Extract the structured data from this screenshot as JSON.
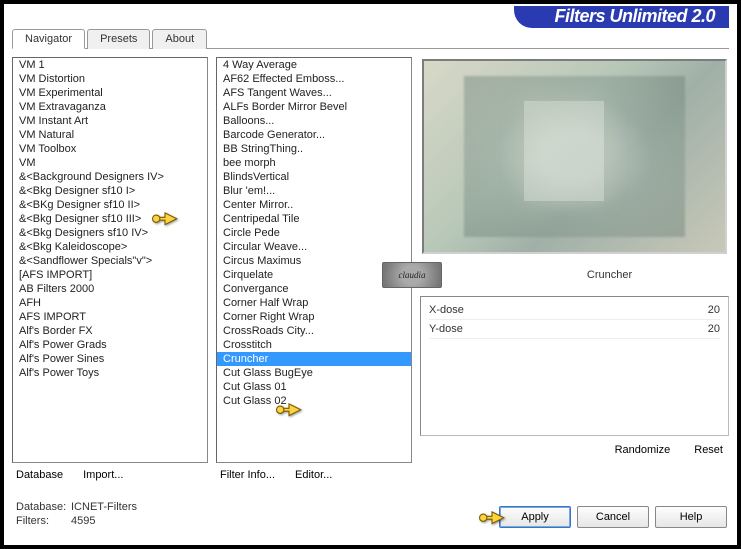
{
  "app_title": "Filters Unlimited 2.0",
  "tabs": [
    "Navigator",
    "Presets",
    "About"
  ],
  "active_tab": 0,
  "categories": [
    "VM 1",
    "VM Distortion",
    "VM Experimental",
    "VM Extravaganza",
    "VM Instant Art",
    "VM Natural",
    "VM Toolbox",
    "VM",
    "&<Background Designers IV>",
    "&<Bkg Designer sf10 I>",
    "&<BKg Designer sf10 II>",
    "&<Bkg Designer sf10 III>",
    "&<Bkg Designers sf10 IV>",
    "&<Bkg Kaleidoscope>",
    "&<Sandflower Specials\"v\">",
    "[AFS IMPORT]",
    "AB Filters 2000",
    "AFH",
    "AFS IMPORT",
    "Alf's Border FX",
    "Alf's Power Grads",
    "Alf's Power Sines",
    "Alf's Power Toys"
  ],
  "selected_category_index": 9,
  "filters": [
    "4 Way Average",
    "AF62 Effected Emboss...",
    "AFS Tangent Waves...",
    "ALFs Border Mirror Bevel",
    "Balloons...",
    "Barcode Generator...",
    "BB StringThing..",
    "bee morph",
    "BlindsVertical",
    "Blur 'em!...",
    "Center Mirror..",
    "Centripedal Tile",
    "Circle Pede",
    "Circular Weave...",
    "Circus Maximus",
    "Cirquelate",
    "Convergance",
    "Corner Half Wrap",
    "Corner Right Wrap",
    "CrossRoads City...",
    "Crosstitch",
    "Cruncher",
    "Cut Glass  BugEye",
    "Cut Glass 01",
    "Cut Glass 02"
  ],
  "selected_filter_index": 21,
  "selected_filter_name": "Cruncher",
  "watermark_text": "claudia",
  "params": [
    {
      "name": "X-dose",
      "value": "20"
    },
    {
      "name": "Y-dose",
      "value": "20"
    }
  ],
  "buttons": {
    "database": "Database",
    "import": "Import...",
    "filter_info": "Filter Info...",
    "editor": "Editor...",
    "randomize": "Randomize",
    "reset": "Reset",
    "apply": "Apply",
    "cancel": "Cancel",
    "help": "Help"
  },
  "status": {
    "db_label": "Database:",
    "db_value": "ICNET-Filters",
    "filters_label": "Filters:",
    "filters_value": "4595"
  }
}
